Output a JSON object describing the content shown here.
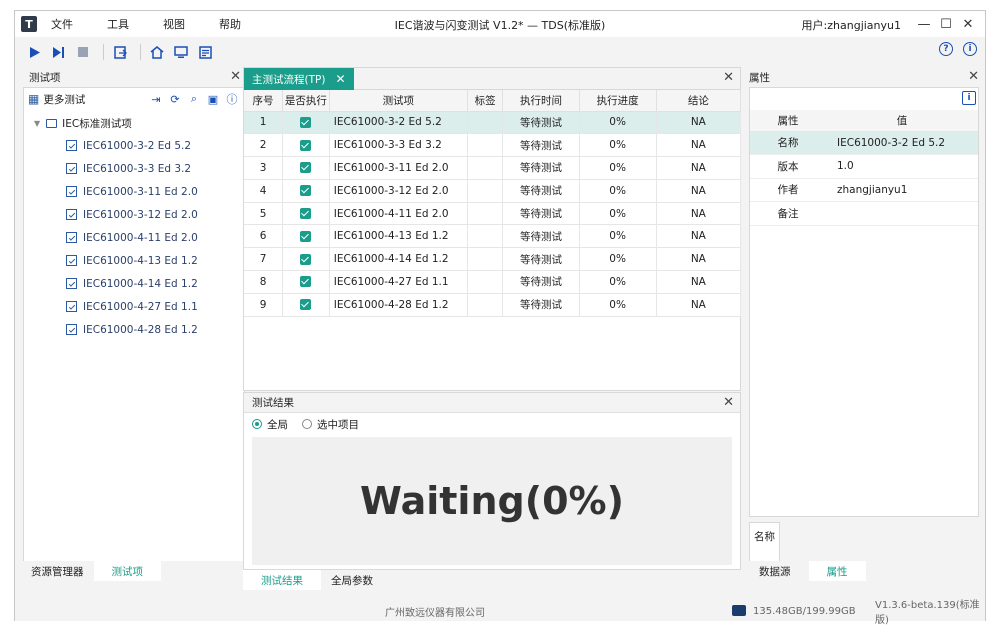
{
  "app": {
    "logo": "T",
    "title": "IEC谐波与闪变测试 V1.2* — TDS(标准版)",
    "user": "用户:zhangjianyu1"
  },
  "menu": [
    "文件",
    "工具",
    "视图",
    "帮助"
  ],
  "window_controls": {
    "minimize": "—",
    "maximize": "☐",
    "close": "✕"
  },
  "toolbar": {
    "icons": [
      "play-icon",
      "step-icon",
      "stop-icon",
      "export-icon",
      "home-icon",
      "monitor-icon",
      "list-icon"
    ],
    "right_icons": [
      "help-icon",
      "info-icon"
    ],
    "help": "?",
    "info": "i"
  },
  "left_panel": {
    "title": "测试项",
    "more_tests": "更多测试",
    "root": "IEC标准测试项",
    "items": [
      "IEC61000-3-2 Ed 5.2",
      "IEC61000-3-3 Ed 3.2",
      "IEC61000-3-11 Ed 2.0",
      "IEC61000-3-12 Ed 2.0",
      "IEC61000-4-11 Ed 2.0",
      "IEC61000-4-13 Ed 1.2",
      "IEC61000-4-14 Ed 1.2",
      "IEC61000-4-27 Ed 1.1",
      "IEC61000-4-28 Ed 1.2"
    ],
    "tabs": [
      "资源管理器",
      "测试项"
    ]
  },
  "center": {
    "tab": "主测试流程(TP)",
    "columns": [
      "序号",
      "是否执行",
      "测试项",
      "标签",
      "执行时间",
      "执行进度",
      "结论"
    ],
    "rows": [
      {
        "no": "1",
        "item": "IEC61000-3-2 Ed 5.2",
        "tag": "",
        "time": "等待测试",
        "progress": "0%",
        "result": "NA"
      },
      {
        "no": "2",
        "item": "IEC61000-3-3 Ed 3.2",
        "tag": "",
        "time": "等待测试",
        "progress": "0%",
        "result": "NA"
      },
      {
        "no": "3",
        "item": "IEC61000-3-11 Ed 2.0",
        "tag": "",
        "time": "等待测试",
        "progress": "0%",
        "result": "NA"
      },
      {
        "no": "4",
        "item": "IEC61000-3-12 Ed 2.0",
        "tag": "",
        "time": "等待测试",
        "progress": "0%",
        "result": "NA"
      },
      {
        "no": "5",
        "item": "IEC61000-4-11 Ed 2.0",
        "tag": "",
        "time": "等待测试",
        "progress": "0%",
        "result": "NA"
      },
      {
        "no": "6",
        "item": "IEC61000-4-13 Ed 1.2",
        "tag": "",
        "time": "等待测试",
        "progress": "0%",
        "result": "NA"
      },
      {
        "no": "7",
        "item": "IEC61000-4-14 Ed 1.2",
        "tag": "",
        "time": "等待测试",
        "progress": "0%",
        "result": "NA"
      },
      {
        "no": "8",
        "item": "IEC61000-4-27 Ed 1.1",
        "tag": "",
        "time": "等待测试",
        "progress": "0%",
        "result": "NA"
      },
      {
        "no": "9",
        "item": "IEC61000-4-28 Ed 1.2",
        "tag": "",
        "time": "等待测试",
        "progress": "0%",
        "result": "NA"
      }
    ]
  },
  "results": {
    "title": "测试结果",
    "radio_all": "全局",
    "radio_selected": "选中项目",
    "status_text": "Waiting(0%)",
    "tabs": [
      "测试结果",
      "全局参数"
    ]
  },
  "right_panel": {
    "title": "属性",
    "col_key": "属性",
    "col_value": "值",
    "rows": [
      {
        "key": "名称",
        "value": "IEC61000-3-2 Ed 5.2"
      },
      {
        "key": "版本",
        "value": "1.0"
      },
      {
        "key": "作者",
        "value": "zhangjianyu1"
      },
      {
        "key": "备注",
        "value": ""
      }
    ],
    "desc_label": "名称",
    "tabs": [
      "数据源",
      "属性"
    ]
  },
  "statusbar": {
    "company": "广州致远仪器有限公司",
    "disk": "135.48GB/199.99GB",
    "version": "V1.3.6-beta.139(标准版)"
  },
  "colors": {
    "accent": "#1a9d8a",
    "icon_blue": "#1a4fb5",
    "selected_row": "#dbeeeb"
  }
}
